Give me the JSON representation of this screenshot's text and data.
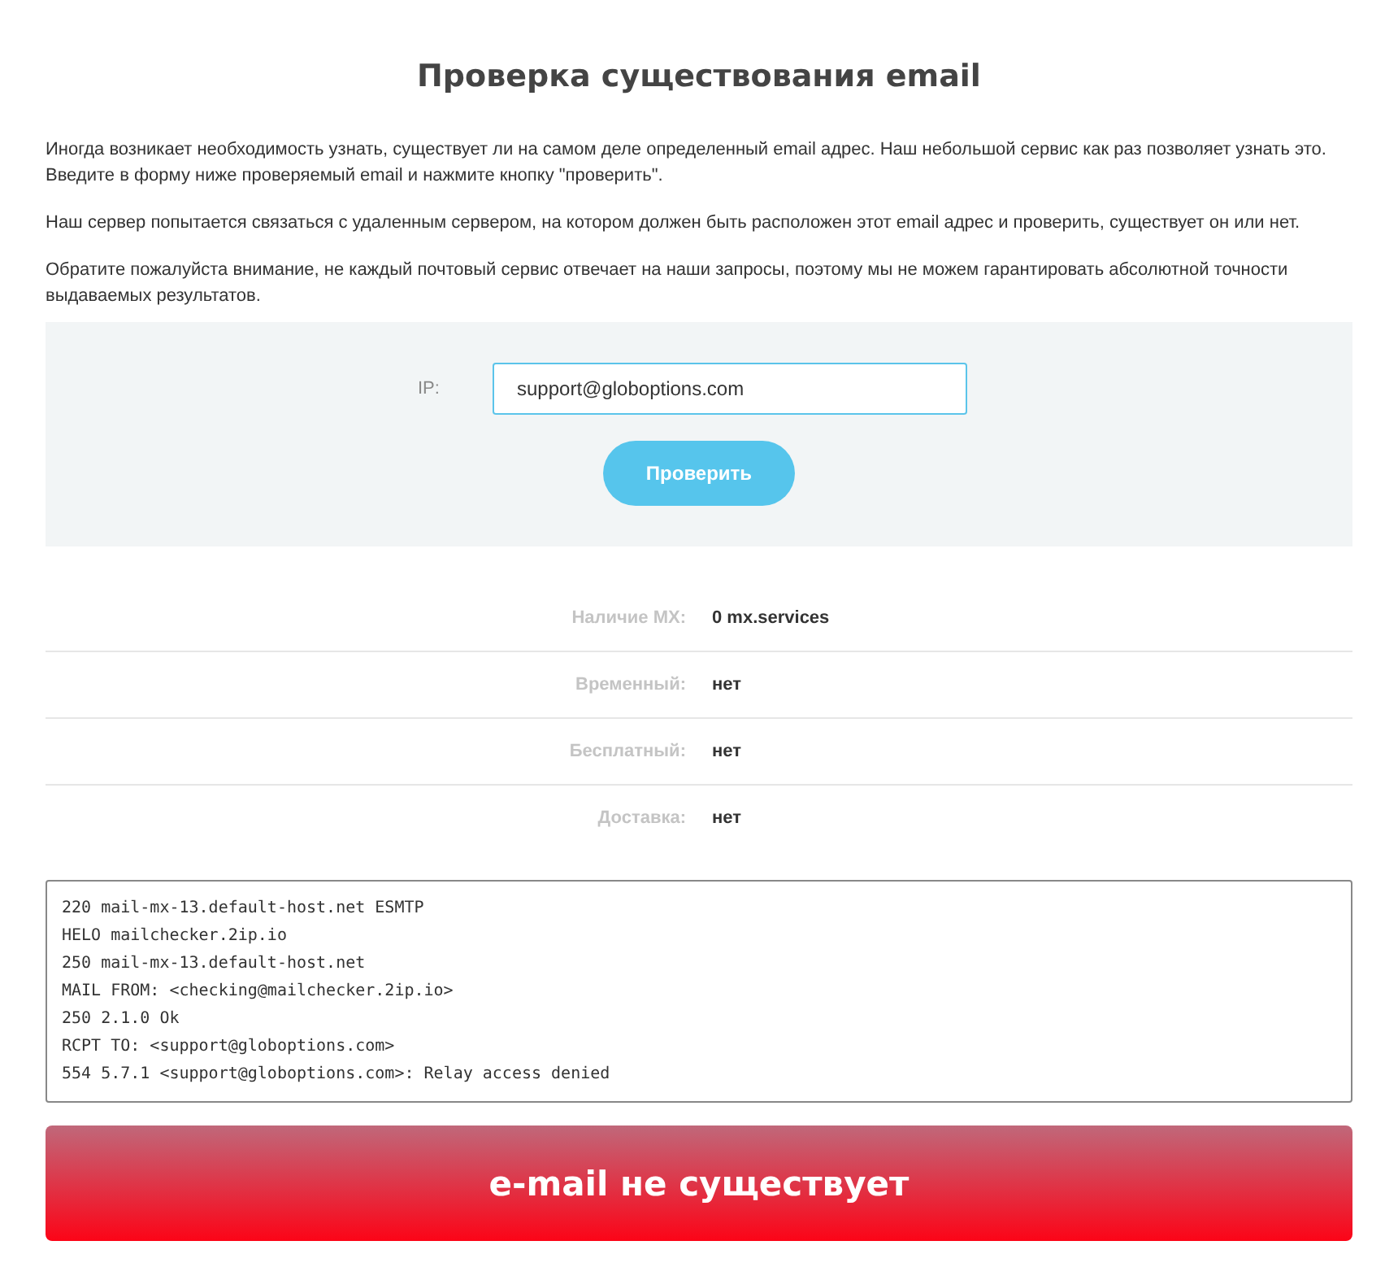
{
  "title": "Проверка существования email",
  "paragraphs": [
    "Иногда возникает необходимость узнать, существует ли на самом деле определенный email адрес. Наш небольшой сервис как раз позволяет узнать это. Введите в форму ниже проверяемый email и нажмите кнопку \"проверить\".",
    "Наш сервер попытается связаться с удаленным сервером, на котором должен быть расположен этот email адрес и проверить, существует он или нет.",
    "Обратите пожалуйста внимание, не каждый почтовый сервис отвечает на наши запросы, поэтому мы не можем гарантировать абсолютной точности выдаваемых результатов."
  ],
  "form": {
    "label": "IP:",
    "value": "support@globoptions.com",
    "button": "Проверить"
  },
  "results": [
    {
      "label": "Наличие MX:",
      "value": "0 mx.services"
    },
    {
      "label": "Временный:",
      "value": "нет"
    },
    {
      "label": "Бесплатный:",
      "value": "нет"
    },
    {
      "label": "Доставка:",
      "value": "нет"
    }
  ],
  "log": [
    "220 mail-mx-13.default-host.net ESMTP",
    "HELO mailchecker.2ip.io",
    "250 mail-mx-13.default-host.net",
    "MAIL FROM: <checking@mailchecker.2ip.io>",
    "250 2.1.0 Ok",
    "RCPT TO: <support@globoptions.com>",
    "554 5.7.1 <support@globoptions.com>: Relay access denied"
  ],
  "verdict": {
    "text": "e-mail не существует",
    "kind": "failure"
  }
}
